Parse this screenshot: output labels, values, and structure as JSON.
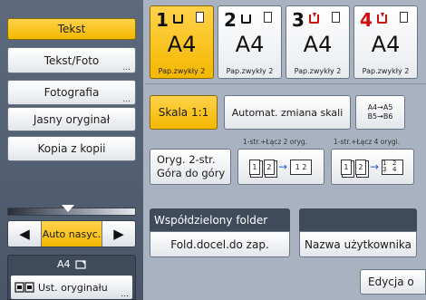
{
  "original_type": {
    "options": [
      {
        "label": "Tekst",
        "active": true,
        "more": false
      },
      {
        "label": "Tekst/Foto",
        "active": false,
        "more": true
      },
      {
        "label": "Fotografia",
        "active": false,
        "more": true
      },
      {
        "label": "Jasny oryginał",
        "active": false,
        "more": false
      },
      {
        "label": "Kopia z kopii",
        "active": false,
        "more": false
      }
    ],
    "more_marker": "..."
  },
  "density": {
    "left_arrow": "◀",
    "right_arrow": "▶",
    "auto_label": "Auto nasyc."
  },
  "original_settings": {
    "size_label": "A4",
    "button_label": "Ust. oryginału",
    "more_marker": "..."
  },
  "trays": [
    {
      "number": "1",
      "size": "A4",
      "paper_type": "Pap.zwykły 2",
      "active": true,
      "warning": false
    },
    {
      "number": "2",
      "size": "A4",
      "paper_type": "Pap.zwykły 2",
      "active": false,
      "warning": false
    },
    {
      "number": "3",
      "size": "A4",
      "paper_type": "Pap.zwykły 2",
      "active": false,
      "warning": true
    },
    {
      "number": "4",
      "size": "A4",
      "paper_type": "Pap.zwykły 2",
      "active": false,
      "warning": true
    }
  ],
  "ratio": {
    "full_size": "Skala 1:1",
    "auto_reduce": "Automat. zmiana skali",
    "a4_a5_line1": "A4→A5",
    "a4_a5_line2": "B5→B6"
  },
  "duplex": {
    "label_combine2": "1-str.+Łącz 2 oryg.",
    "label_combine4": "1-str.+Łącz 4 orygi.",
    "duplex_line1": "Oryg. 2-str.",
    "duplex_line2": "Góra do góry",
    "combine2_pages": [
      "1",
      "2",
      "1",
      "2"
    ],
    "combine4_pages": [
      "1",
      "2",
      "1",
      "2",
      "3",
      "4"
    ],
    "arrow": "→"
  },
  "storage": {
    "shared_folder": "Współdzielony folder",
    "dest_folder": "Fold.docel.do zap.",
    "user_name": "Nazwa użytkownika"
  },
  "bottom": {
    "edit_label": "Edycja o"
  },
  "colors": {
    "active_yellow": "#f4b800",
    "panel_dark": "#4a5668",
    "warning_red": "#d01010"
  }
}
